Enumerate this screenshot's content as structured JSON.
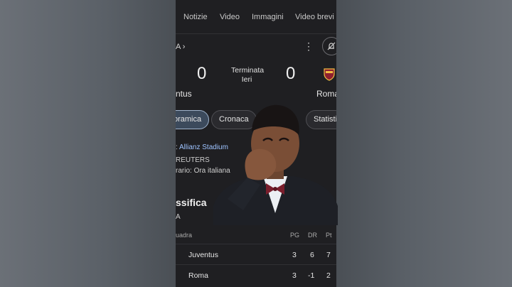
{
  "tabs": [
    "Notizie",
    "Video",
    "Immagini",
    "Video brevi"
  ],
  "league": "A ›",
  "match": {
    "home_score": "0",
    "away_score": "0",
    "status_line1": "Terminata",
    "status_line2": "Ieri",
    "home_team": "ntus",
    "away_team": "Roma"
  },
  "chips": [
    "oramica",
    "Cronaca",
    "Statisti"
  ],
  "info": {
    "venue_label": ":",
    "venue": "Allianz Stadium",
    "source": "REUTERS",
    "time_label": "rario:",
    "time": "Ora italiana"
  },
  "standings": {
    "title": "ssifica",
    "subtitle": "A",
    "headers": {
      "team": "uadra",
      "pg": "PG",
      "dr": "DR",
      "pt": "Pt"
    },
    "rows": [
      {
        "team": "Juventus",
        "pg": "3",
        "dr": "6",
        "pt": "7"
      },
      {
        "team": "Roma",
        "pg": "3",
        "dr": "-1",
        "pt": "2"
      }
    ]
  },
  "colors": {
    "background": "#5f656c",
    "panel": "#1f1f22",
    "link": "#9ec3ff",
    "roma": "#8e1f2f",
    "roma_gold": "#f0bc42"
  }
}
